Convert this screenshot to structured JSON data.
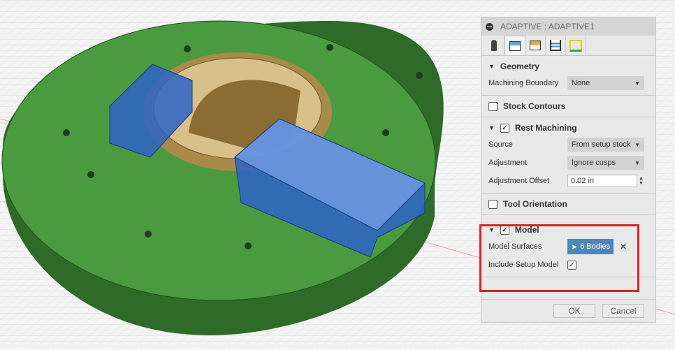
{
  "panel": {
    "title": "ADAPTIVE : ADAPTIVE1",
    "tabs": [
      "tool-icon",
      "geometry-icon",
      "heights-icon",
      "passes-icon",
      "linking-icon"
    ],
    "geometry": {
      "title": "Geometry",
      "machining_boundary_label": "Machining Boundary",
      "machining_boundary_value": "None"
    },
    "stock_contours": {
      "title": "Stock Contours",
      "checked": false
    },
    "rest_machining": {
      "title": "Rest Machining",
      "checked": true,
      "source_label": "Source",
      "source_value": "From setup stock",
      "adjustment_label": "Adjustment",
      "adjustment_value": "Ignore cusps",
      "offset_label": "Adjustment Offset",
      "offset_value": "0.02 in"
    },
    "tool_orientation": {
      "title": "Tool Orientation",
      "checked": false
    },
    "model": {
      "title": "Model",
      "checked": true,
      "surfaces_label": "Model Surfaces",
      "surfaces_value": "6 Bodies",
      "include_label": "Include Setup Model",
      "include_checked": true
    },
    "ok": "OK",
    "cancel": "Cancel"
  },
  "colors": {
    "highlight": "#e81c24",
    "base": "#3f8f36",
    "parts": "#2d63c8",
    "accent": "#4f86b9"
  }
}
